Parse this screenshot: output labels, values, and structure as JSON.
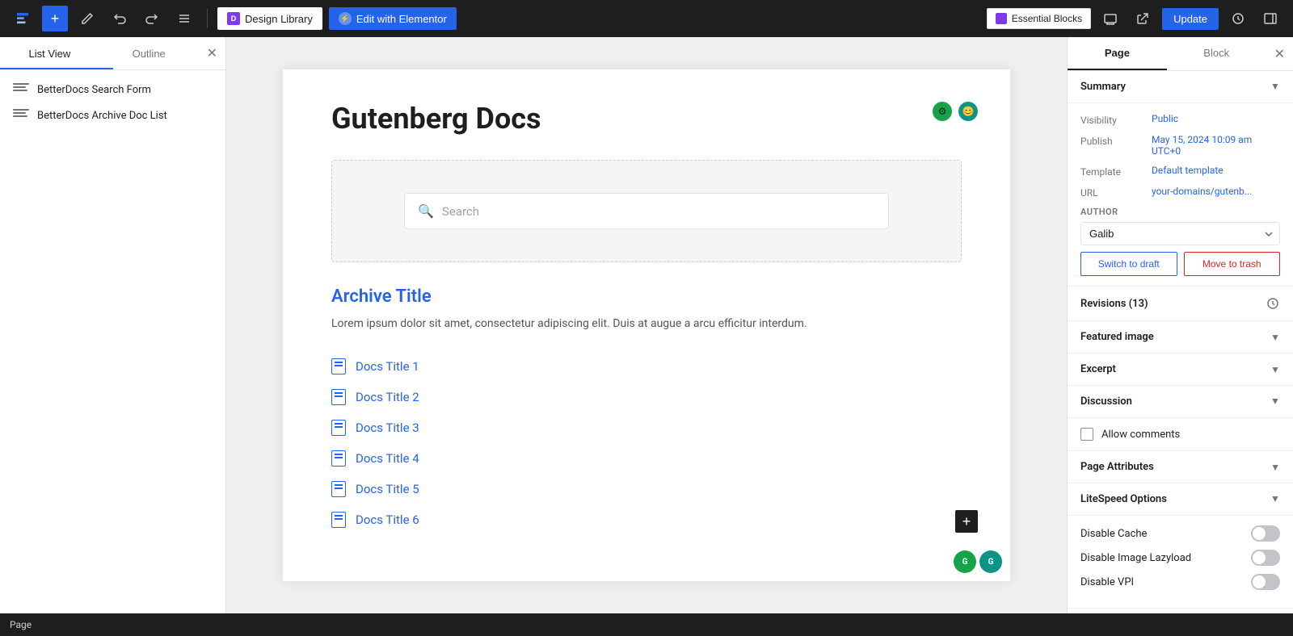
{
  "topbar": {
    "add_label": "+",
    "design_library_label": "Design Library",
    "edit_with_elementor_label": "Edit with Elementor",
    "essential_blocks_label": "Essential Blocks",
    "update_label": "Update"
  },
  "left_sidebar": {
    "tab1_label": "List View",
    "tab2_label": "Outline",
    "items": [
      {
        "label": "BetterDocs Search Form"
      },
      {
        "label": "BetterDocs Archive Doc List"
      }
    ]
  },
  "canvas": {
    "page_title": "Gutenberg Docs",
    "search_placeholder": "Search",
    "archive_title": "Archive Title",
    "archive_desc": "Lorem ipsum dolor sit amet, consectetur adipiscing elit. Duis at augue a arcu efficitur interdum.",
    "docs": [
      {
        "title": "Docs Title 1"
      },
      {
        "title": "Docs Title 2"
      },
      {
        "title": "Docs Title 3"
      },
      {
        "title": "Docs Title 4"
      },
      {
        "title": "Docs Title 5"
      },
      {
        "title": "Docs Title 6"
      }
    ]
  },
  "right_sidebar": {
    "tab_page_label": "Page",
    "tab_block_label": "Block",
    "summary": {
      "title": "Summary",
      "visibility_label": "Visibility",
      "visibility_value": "Public",
      "publish_label": "Publish",
      "publish_value": "May 15, 2024 10:09 am UTC+0",
      "template_label": "Template",
      "template_value": "Default template",
      "url_label": "URL",
      "url_value": "your-domains/gutenb...",
      "author_label": "AUTHOR",
      "author_value": "Galib",
      "switch_draft_label": "Switch to draft",
      "move_trash_label": "Move to trash"
    },
    "revisions": {
      "label": "Revisions (13)"
    },
    "featured_image": {
      "label": "Featured image"
    },
    "excerpt": {
      "label": "Excerpt"
    },
    "discussion": {
      "title": "Discussion",
      "allow_comments_label": "Allow comments"
    },
    "page_attributes": {
      "label": "Page Attributes"
    },
    "litespeed": {
      "title": "LiteSpeed Options",
      "disable_cache_label": "Disable Cache",
      "disable_image_lazyload_label": "Disable Image Lazyload",
      "disable_vpi_label": "Disable VPI"
    }
  },
  "bottom_bar": {
    "label": "Page"
  }
}
